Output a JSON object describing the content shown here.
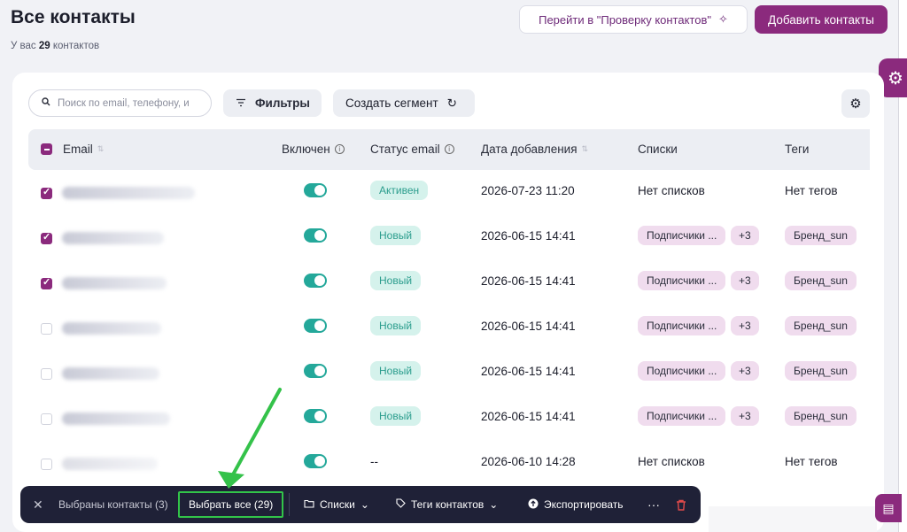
{
  "header": {
    "title": "Все контакты",
    "subtitle_prefix": "У вас",
    "subtitle_count": "29",
    "subtitle_suffix": "контактов",
    "check_button": "Перейти в \"Проверку контактов\"",
    "add_button": "Добавить контакты"
  },
  "toolbar": {
    "search_placeholder": "Поиск по email, телефону, и",
    "filters_label": "Фильтры",
    "segment_label": "Создать сегмент"
  },
  "table": {
    "columns": [
      "Email",
      "Включен",
      "Статус email",
      "Дата добавления",
      "Списки",
      "Теги"
    ],
    "rows": [
      {
        "checked": true,
        "status": "Активен",
        "date": "2026-07-23 11:20",
        "lists": "Нет списков",
        "lists_more": "",
        "tags": "Нет тегов"
      },
      {
        "checked": true,
        "status": "Новый",
        "date": "2026-06-15 14:41",
        "lists": "Подписчики ...",
        "lists_more": "+3",
        "tags": "Бренд_sun"
      },
      {
        "checked": true,
        "status": "Новый",
        "date": "2026-06-15 14:41",
        "lists": "Подписчики ...",
        "lists_more": "+3",
        "tags": "Бренд_sun"
      },
      {
        "checked": false,
        "status": "Новый",
        "date": "2026-06-15 14:41",
        "lists": "Подписчики ...",
        "lists_more": "+3",
        "tags": "Бренд_sun"
      },
      {
        "checked": false,
        "status": "Новый",
        "date": "2026-06-15 14:41",
        "lists": "Подписчики ...",
        "lists_more": "+3",
        "tags": "Бренд_sun"
      },
      {
        "checked": false,
        "status": "Новый",
        "date": "2026-06-15 14:41",
        "lists": "Подписчики ...",
        "lists_more": "+3",
        "tags": "Бренд_sun"
      },
      {
        "checked": false,
        "status": "--",
        "date": "2026-06-10 14:28",
        "lists": "Нет списков",
        "lists_more": "",
        "tags": "Нет тегов"
      }
    ]
  },
  "selection_bar": {
    "selected": "Выбраны контакты (3)",
    "select_all": "Выбрать все (29)",
    "lists": "Списки",
    "tags": "Теги контактов",
    "export": "Экспортировать",
    "more": "···"
  },
  "colors": {
    "brand": "#8b2a7d",
    "accent_teal": "#24a89a",
    "highlight_green": "#32c449"
  }
}
